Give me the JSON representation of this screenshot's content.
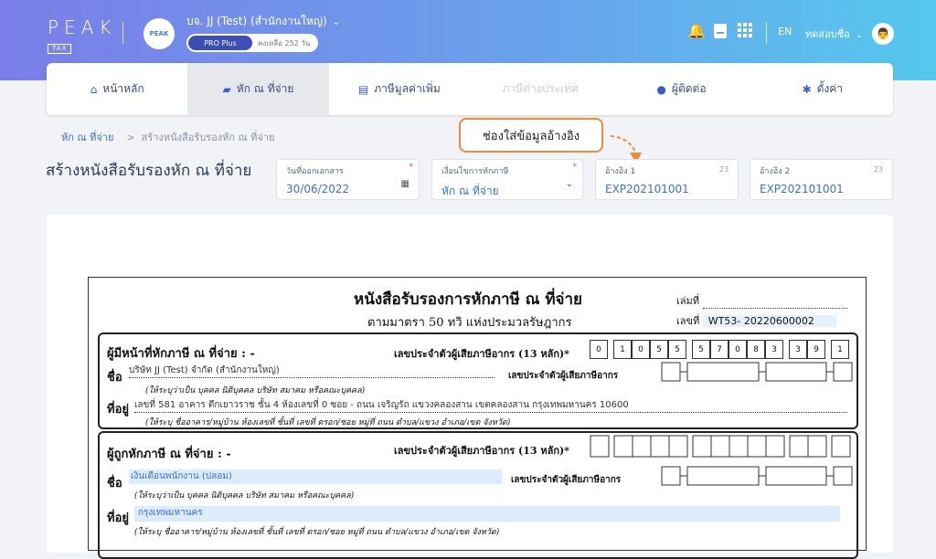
{
  "brand": {
    "name": "PEAK",
    "tag": "TAX"
  },
  "company": {
    "name": "บจ. JJ (Test) (สำนักงานใหญ่)",
    "logo_text": "PEAK",
    "plan": "PRO Plus",
    "remaining": "คงเหลือ 252 วัน"
  },
  "top_icons": [
    "bell-icon",
    "document-icon",
    "grid-icon"
  ],
  "lang": "EN",
  "user": "ทดสอบชื่อ",
  "nav": [
    {
      "label": "หน้าหลัก",
      "icon": "home-icon",
      "state": "normal"
    },
    {
      "label": "หัก ณ ที่จ่าย",
      "icon": "wallet-icon",
      "state": "active"
    },
    {
      "label": "ภาษีมูลค่าเพิ่ม",
      "icon": "receipt-icon",
      "state": "normal"
    },
    {
      "label": "ภาษีต่างประเทศ",
      "icon": "",
      "state": "disabled"
    },
    {
      "label": "ผู้ติดต่อ",
      "icon": "person-icon",
      "state": "normal"
    },
    {
      "label": "ตั้งค่า",
      "icon": "gear-icon",
      "state": "normal"
    }
  ],
  "breadcrumb": {
    "link": "หัก ณ ที่จ่าย",
    "sep": ">",
    "current": "สร้างหนังสือรับรองหัก ณ ที่จ่าย"
  },
  "callout": "ช่องใส่ข้อมูลอ้างอิง",
  "page_title": "สร้างหนังสือรับรองหัก ณ ที่จ่าย",
  "fields": {
    "doc_date": {
      "label": "วันที่ออกเอกสาร",
      "value": "30/06/2022"
    },
    "condition": {
      "label": "เงื่อนไขการหักภาษี",
      "value": "หัก ณ ที่จ่าย"
    },
    "ref1": {
      "label": "อ้างอิง 1",
      "count": "23",
      "value": "EXP202101001"
    },
    "ref2": {
      "label": "อ้างอิง 2",
      "count": "23",
      "value": "EXP202101001"
    }
  },
  "doc": {
    "title": "หนังสือรับรองการหักภาษี ณ ที่จ่าย",
    "subtitle": "ตามมาตรา 50 ทวิ แห่งประมวลรัษฎากร",
    "book_label": "เล่มที่",
    "no_label": "เลขที่",
    "no_value": "WT53- 20220600002",
    "payer": {
      "heading": "ผู้มีหน้าที่หักภาษี ณ ที่จ่าย : -",
      "taxid_label": "เลขประจำตัวผู้เสียภาษีอากร (13 หลัก)*",
      "digits": [
        "0",
        "1",
        "0",
        "5",
        "5",
        "5",
        "7",
        "0",
        "8",
        "3",
        "3",
        "9",
        "1"
      ],
      "name_label": "ชื่อ",
      "name_value": "บริษัท JJ (Test) จำกัด (สำนักงานใหญ่)",
      "taxid2_label": "เลขประจำตัวผู้เสียภาษีอากร",
      "name_hint": "(ให้ระบุว่าเป็น บุคคล นิติบุคคล บริษัท สมาคม หรือคณะบุคคล)",
      "addr_label": "ที่อยู่",
      "addr_value": "เลขที่ 581 อาคาร ตึกเยาวราช ชั้น 4 ห้องเลขที่ 0 ซอย - ถนน เจริญรัถ แขวงคลองสาน เขตคลองสาน กรุงเทพมหานคร 10600",
      "addr_hint": "(ให้ระบุ ชื่ออาคาร/หมู่บ้าน ห้องเลขที่ ชั้นที่ เลขที่ ตรอก/ซอย หมู่ที่ ถนน ตำบล/แขวง อำเภอ/เขต จังหวัด)"
    },
    "payee": {
      "heading": "ผู้ถูกหักภาษี ณ ที่จ่าย : -",
      "taxid_label": "เลขประจำตัวผู้เสียภาษีอากร (13 หลัก)*",
      "name_label": "ชื่อ",
      "name_value": "เงินเดือนพนักงาน (ปลอม)",
      "taxid2_label": "เลขประจำตัวผู้เสียภาษีอากร",
      "name_hint": "(ให้ระบุว่าเป็น บุคคล นิติบุคคล บริษัท สมาคม หรือคณะบุคคล)",
      "addr_label": "ที่อยู่",
      "addr_value": "กรุงเทพมหานคร",
      "addr_hint": "(ให้ระบุ ชื่ออาคาร/หมู่บ้าน ห้องเลขที่ ชั้นที่ เลขที่ ตรอก/ซอย หมู่ที่ ถนน ตำบล/แขวง อำเภอ/เขต จังหวัด)"
    }
  }
}
